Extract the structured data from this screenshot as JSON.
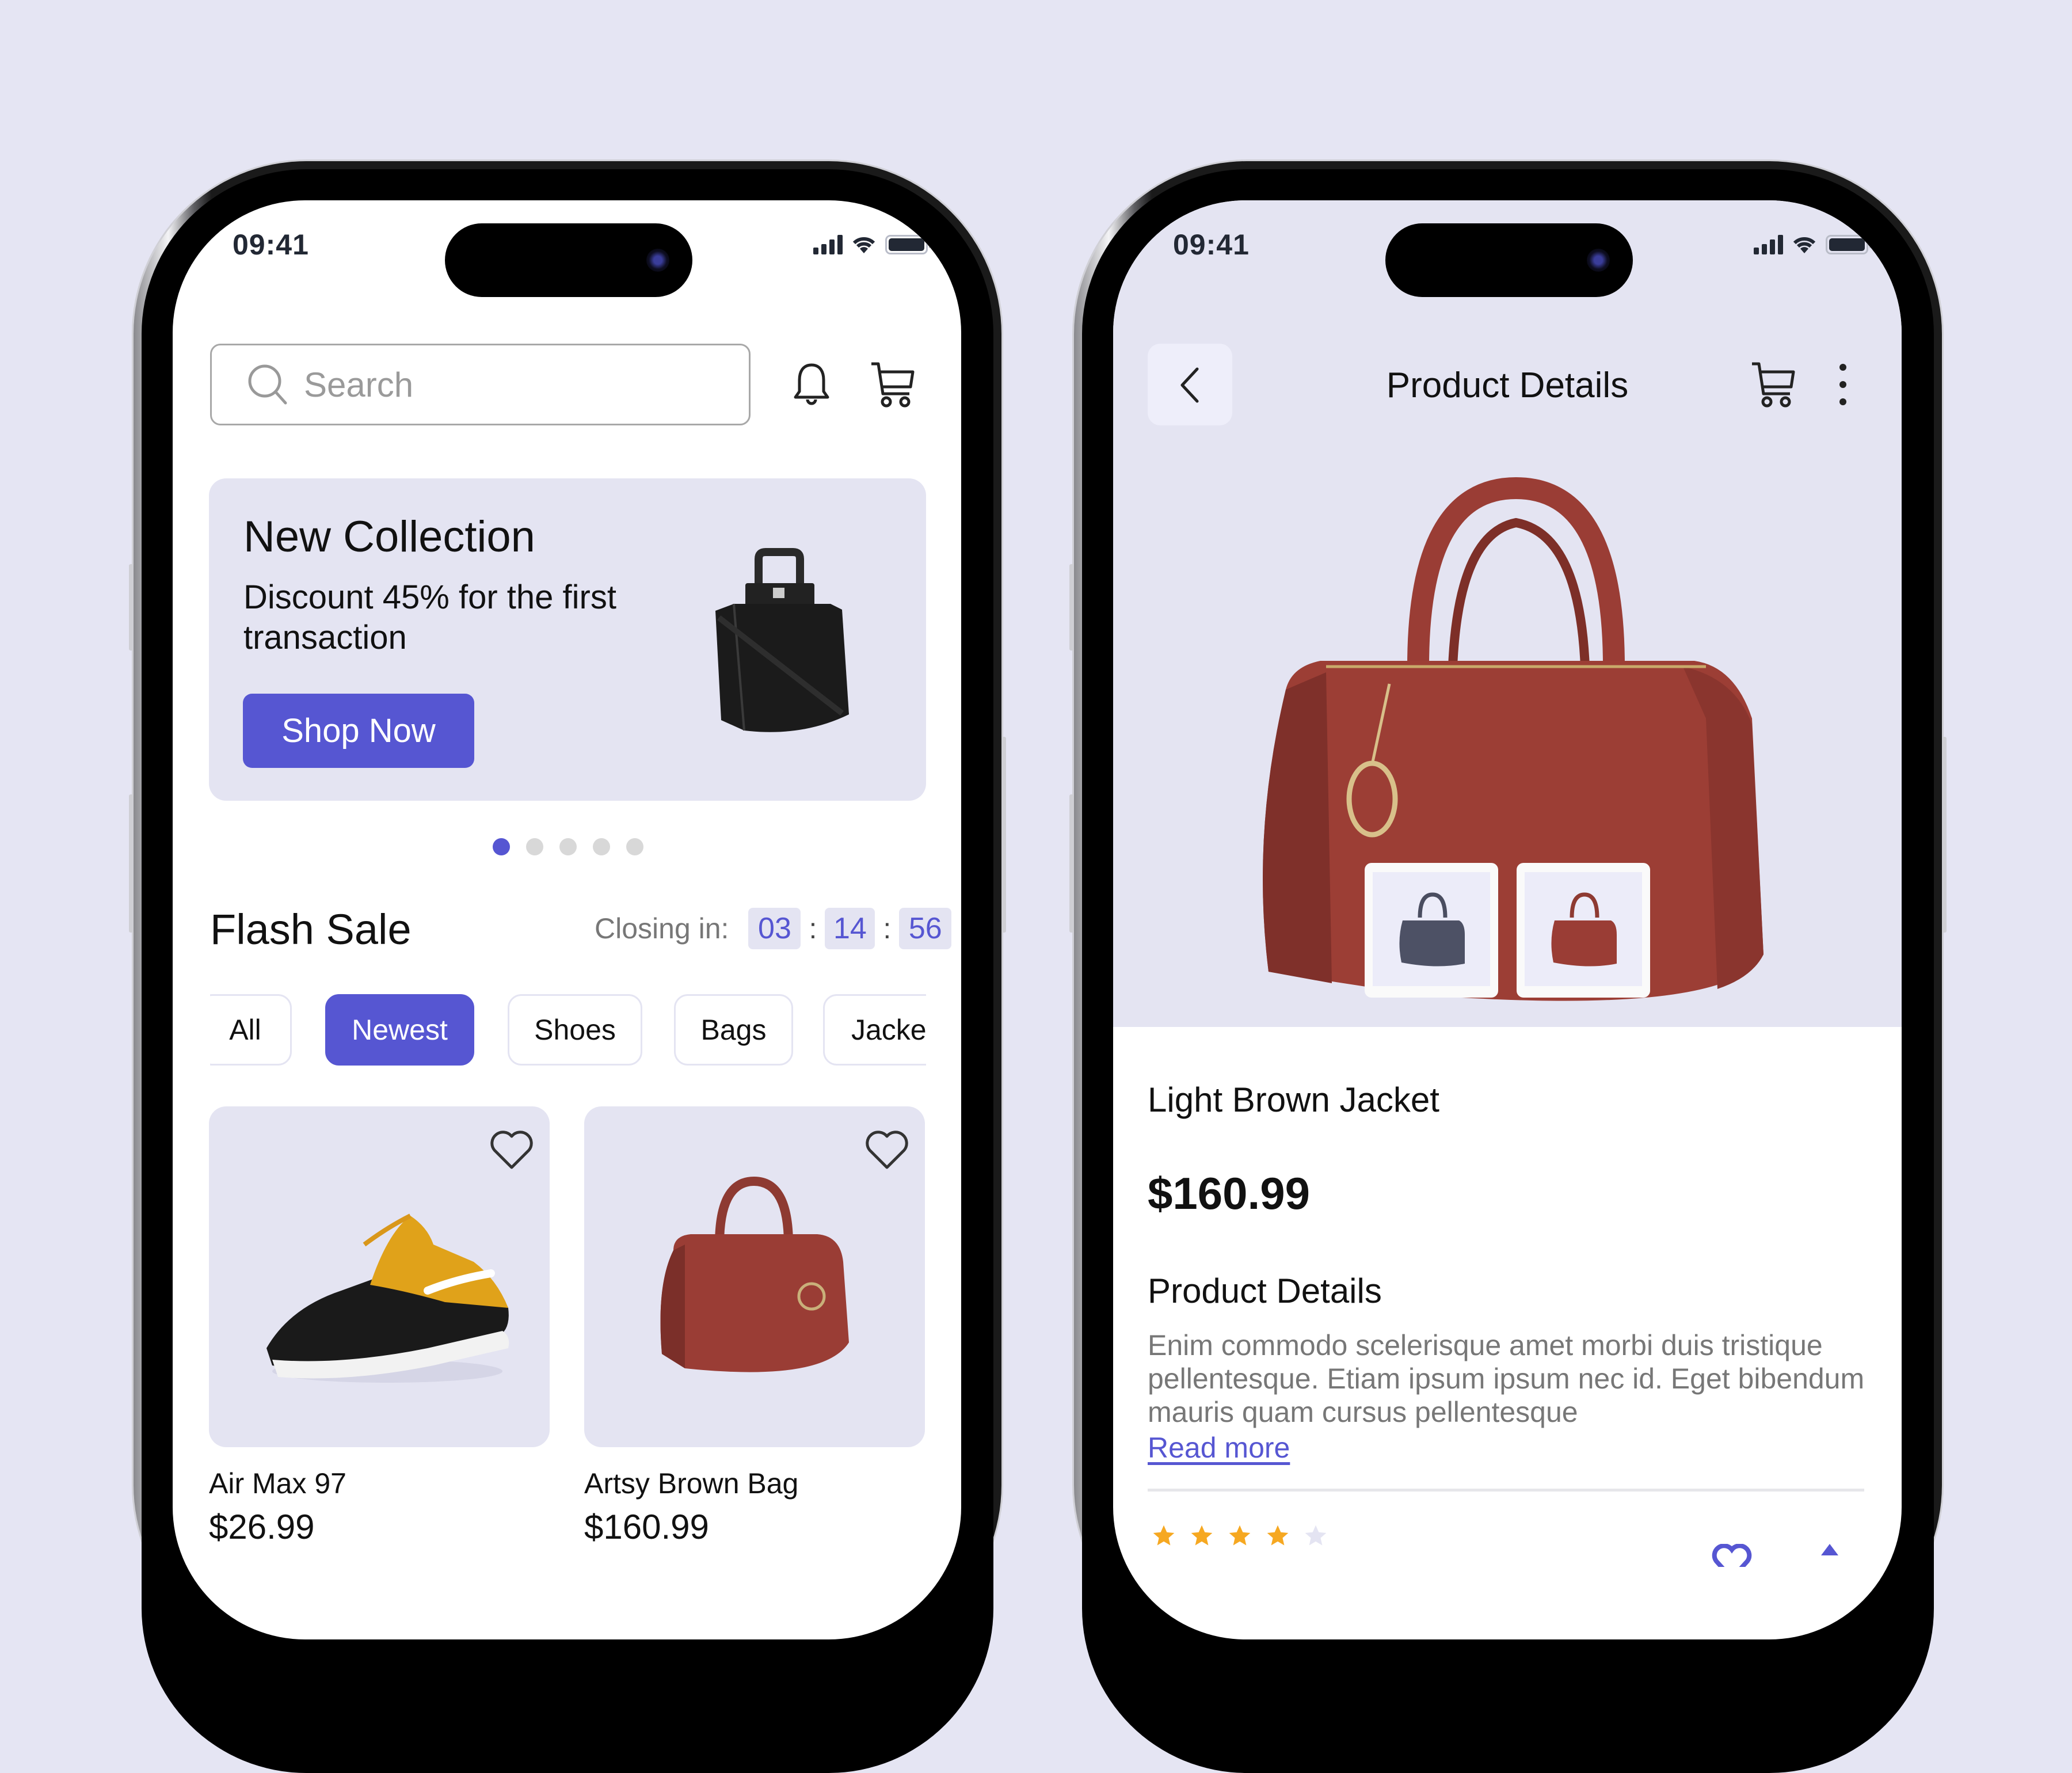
{
  "colors": {
    "accent": "#5656d2",
    "lavender": "#e4e4f2",
    "background": "#e5e5f3",
    "star": "#f6a821",
    "star_empty": "#e4e4f2"
  },
  "left_phone": {
    "status": {
      "time": "09:41"
    },
    "search": {
      "placeholder": "Search",
      "icon": "search-icon"
    },
    "header_icons": [
      "bell-icon",
      "cart-icon"
    ],
    "banner": {
      "title": "New Collection",
      "description": "Discount 45% for the first transaction",
      "button": "Shop Now",
      "carousel": {
        "total": 5,
        "active_index": 0
      }
    },
    "flash_sale": {
      "title": "Flash Sale",
      "closing_label": "Closing in:",
      "timer": {
        "hours": "03",
        "minutes": "14",
        "seconds": "56"
      },
      "separator": ":"
    },
    "categories": [
      {
        "label": "All",
        "active": false
      },
      {
        "label": "Newest",
        "active": true
      },
      {
        "label": "Shoes",
        "active": false
      },
      {
        "label": "Bags",
        "active": false
      },
      {
        "label": "Jacke",
        "active": false
      }
    ],
    "products": [
      {
        "name": "Air Max 97",
        "price": "$26.99",
        "image": "sneaker-image",
        "favorite": false
      },
      {
        "name": "Artsy Brown Bag",
        "price": "$160.99",
        "image": "brown-bag-image",
        "favorite": false
      }
    ]
  },
  "right_phone": {
    "status": {
      "time": "09:41"
    },
    "header": {
      "title": "Product Details",
      "back_icon": "chevron-left-icon",
      "cart_icon": "cart-icon",
      "more_icon": "more-vertical-icon"
    },
    "gallery": {
      "main_image": "brown-bag-image",
      "thumbnails": [
        "navy-bag-thumbnail",
        "brown-bag-thumbnail"
      ]
    },
    "product": {
      "name": "Light Brown Jacket",
      "price": "$160.99",
      "section_title": "Product Details",
      "description": "Enim commodo scelerisque amet morbi duis tristique pellentesque. Etiam ipsum ipsum nec id. Eget bibendum mauris quam cursus pellentesque",
      "read_more": "Read more",
      "rating": {
        "value": 4,
        "max": 5
      }
    },
    "footer_icons": [
      "heart-icon",
      "share-icon"
    ]
  }
}
